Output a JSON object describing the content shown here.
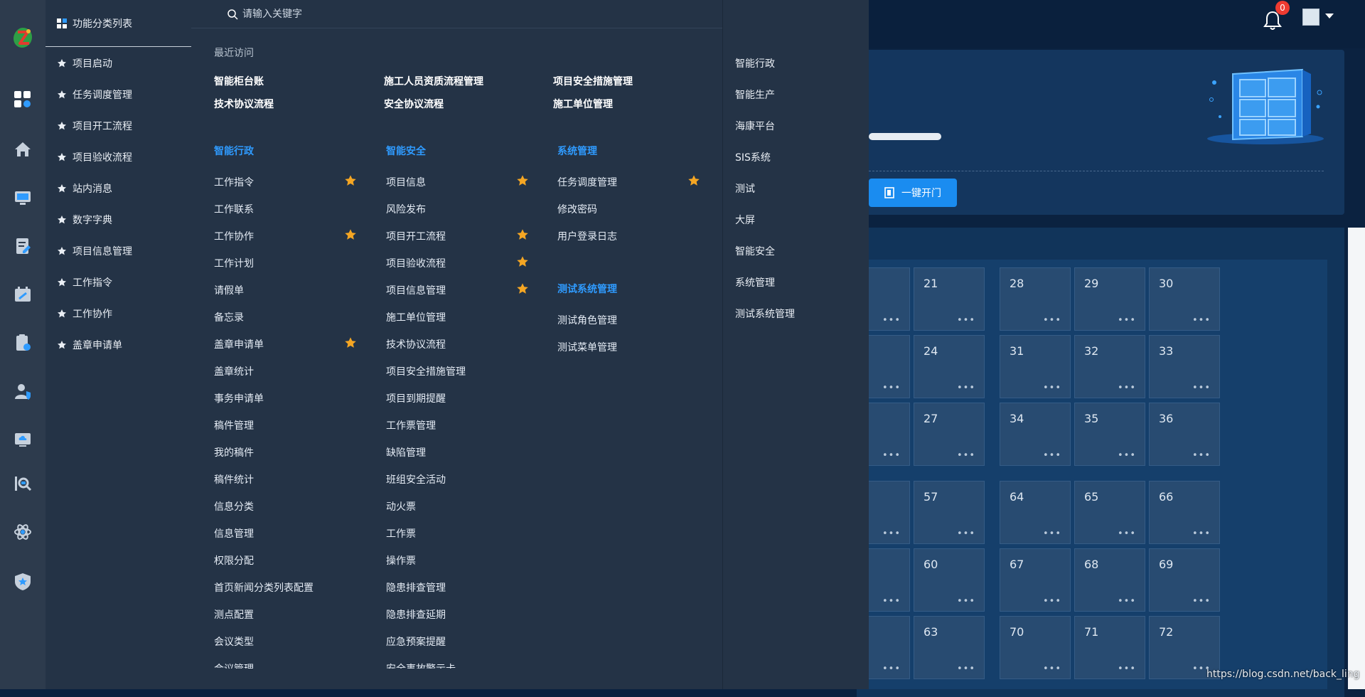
{
  "header": {
    "notification_count": "0"
  },
  "dashboard": {
    "open_door_label": "一键开门",
    "tiles": [
      {
        "label": "21"
      },
      {
        "label": "28"
      },
      {
        "label": "29"
      },
      {
        "label": "30"
      },
      {
        "label": "24"
      },
      {
        "label": "31"
      },
      {
        "label": "32"
      },
      {
        "label": "33"
      },
      {
        "label": "27"
      },
      {
        "label": "34"
      },
      {
        "label": "35"
      },
      {
        "label": "36"
      },
      {
        "label": "57"
      },
      {
        "label": "64"
      },
      {
        "label": "65"
      },
      {
        "label": "66"
      },
      {
        "label": "60"
      },
      {
        "label": "67"
      },
      {
        "label": "68"
      },
      {
        "label": "69"
      },
      {
        "label": "63"
      },
      {
        "label": "70"
      },
      {
        "label": "71"
      },
      {
        "label": "72"
      }
    ],
    "tile_more": "•••",
    "watermark": "https://blog.csdn.net/back_ling"
  },
  "favorites": {
    "title": "功能分类列表",
    "items": [
      {
        "label": "项目启动"
      },
      {
        "label": "任务调度管理"
      },
      {
        "label": "项目开工流程"
      },
      {
        "label": "项目验收流程"
      },
      {
        "label": "站内消息"
      },
      {
        "label": "数字字典"
      },
      {
        "label": "项目信息管理"
      },
      {
        "label": "工作指令"
      },
      {
        "label": "工作协作"
      },
      {
        "label": "盖章申请单"
      }
    ]
  },
  "menu": {
    "search_placeholder": "请输入关键字",
    "recent_title": "最近访问",
    "recent": [
      {
        "label": "智能柜台账"
      },
      {
        "label": "施工人员资质流程管理"
      },
      {
        "label": "项目安全措施管理"
      },
      {
        "label": "技术协议流程"
      },
      {
        "label": "安全协议流程"
      },
      {
        "label": "施工单位管理"
      }
    ],
    "columns": [
      {
        "title": "智能行政",
        "items": [
          {
            "label": "工作指令",
            "starred": true
          },
          {
            "label": "工作联系",
            "starred": false
          },
          {
            "label": "工作协作",
            "starred": true
          },
          {
            "label": "工作计划",
            "starred": false
          },
          {
            "label": "请假单",
            "starred": false
          },
          {
            "label": "备忘录",
            "starred": false
          },
          {
            "label": "盖章申请单",
            "starred": true
          },
          {
            "label": "盖章统计",
            "starred": false
          },
          {
            "label": "事务申请单",
            "starred": false
          },
          {
            "label": "稿件管理",
            "starred": false
          },
          {
            "label": "我的稿件",
            "starred": false
          },
          {
            "label": "稿件统计",
            "starred": false
          },
          {
            "label": "信息分类",
            "starred": false
          },
          {
            "label": "信息管理",
            "starred": false
          },
          {
            "label": "权限分配",
            "starred": false
          },
          {
            "label": "首页新闻分类列表配置",
            "starred": false
          },
          {
            "label": "测点配置",
            "starred": false
          },
          {
            "label": "会议类型",
            "starred": false
          },
          {
            "label": "会议管理",
            "starred": false
          }
        ]
      },
      {
        "title": "智能安全",
        "items": [
          {
            "label": "项目信息",
            "starred": true
          },
          {
            "label": "风险发布",
            "starred": false
          },
          {
            "label": "项目开工流程",
            "starred": true
          },
          {
            "label": "项目验收流程",
            "starred": true
          },
          {
            "label": "项目信息管理",
            "starred": true
          },
          {
            "label": "施工单位管理",
            "starred": false
          },
          {
            "label": "技术协议流程",
            "starred": false
          },
          {
            "label": "项目安全措施管理",
            "starred": false
          },
          {
            "label": "项目到期提醒",
            "starred": false
          },
          {
            "label": "工作票管理",
            "starred": false
          },
          {
            "label": "缺陷管理",
            "starred": false
          },
          {
            "label": "班组安全活动",
            "starred": false
          },
          {
            "label": "动火票",
            "starred": false
          },
          {
            "label": "工作票",
            "starred": false
          },
          {
            "label": "操作票",
            "starred": false
          },
          {
            "label": "隐患排查管理",
            "starred": false
          },
          {
            "label": "隐患排查延期",
            "starred": false
          },
          {
            "label": "应急预案提醒",
            "starred": false
          },
          {
            "label": "安全事故警示卡",
            "starred": false
          }
        ]
      },
      {
        "title": "系统管理",
        "items": [
          {
            "label": "任务调度管理",
            "starred": true
          },
          {
            "label": "修改密码",
            "starred": false
          },
          {
            "label": "用户登录日志",
            "starred": false
          }
        ],
        "sub_title": "测试系统管理",
        "sub_items": [
          {
            "label": "测试角色管理"
          },
          {
            "label": "测试菜单管理"
          }
        ]
      }
    ]
  },
  "category_nav": {
    "items": [
      {
        "label": "智能行政"
      },
      {
        "label": "智能生产"
      },
      {
        "label": "海康平台"
      },
      {
        "label": "SIS系统"
      },
      {
        "label": "测试"
      },
      {
        "label": "大屏"
      },
      {
        "label": "智能安全"
      },
      {
        "label": "系统管理"
      },
      {
        "label": "测试系统管理"
      }
    ]
  },
  "rail_icons": [
    "dashboard-grid-icon",
    "home-icon",
    "monitor-icon",
    "document-edit-icon",
    "calendar-tools-icon",
    "clipboard-settings-icon",
    "user-shield-icon",
    "cloud-screen-icon",
    "data-search-icon",
    "atom-icon",
    "shield-star-icon"
  ],
  "colors": {
    "accent": "#2f9bff",
    "star": "#f5a623",
    "panel": "#243346",
    "rail": "#2d3b4d",
    "badge": "#ee3b31",
    "primary_button": "#1a8cf0"
  }
}
